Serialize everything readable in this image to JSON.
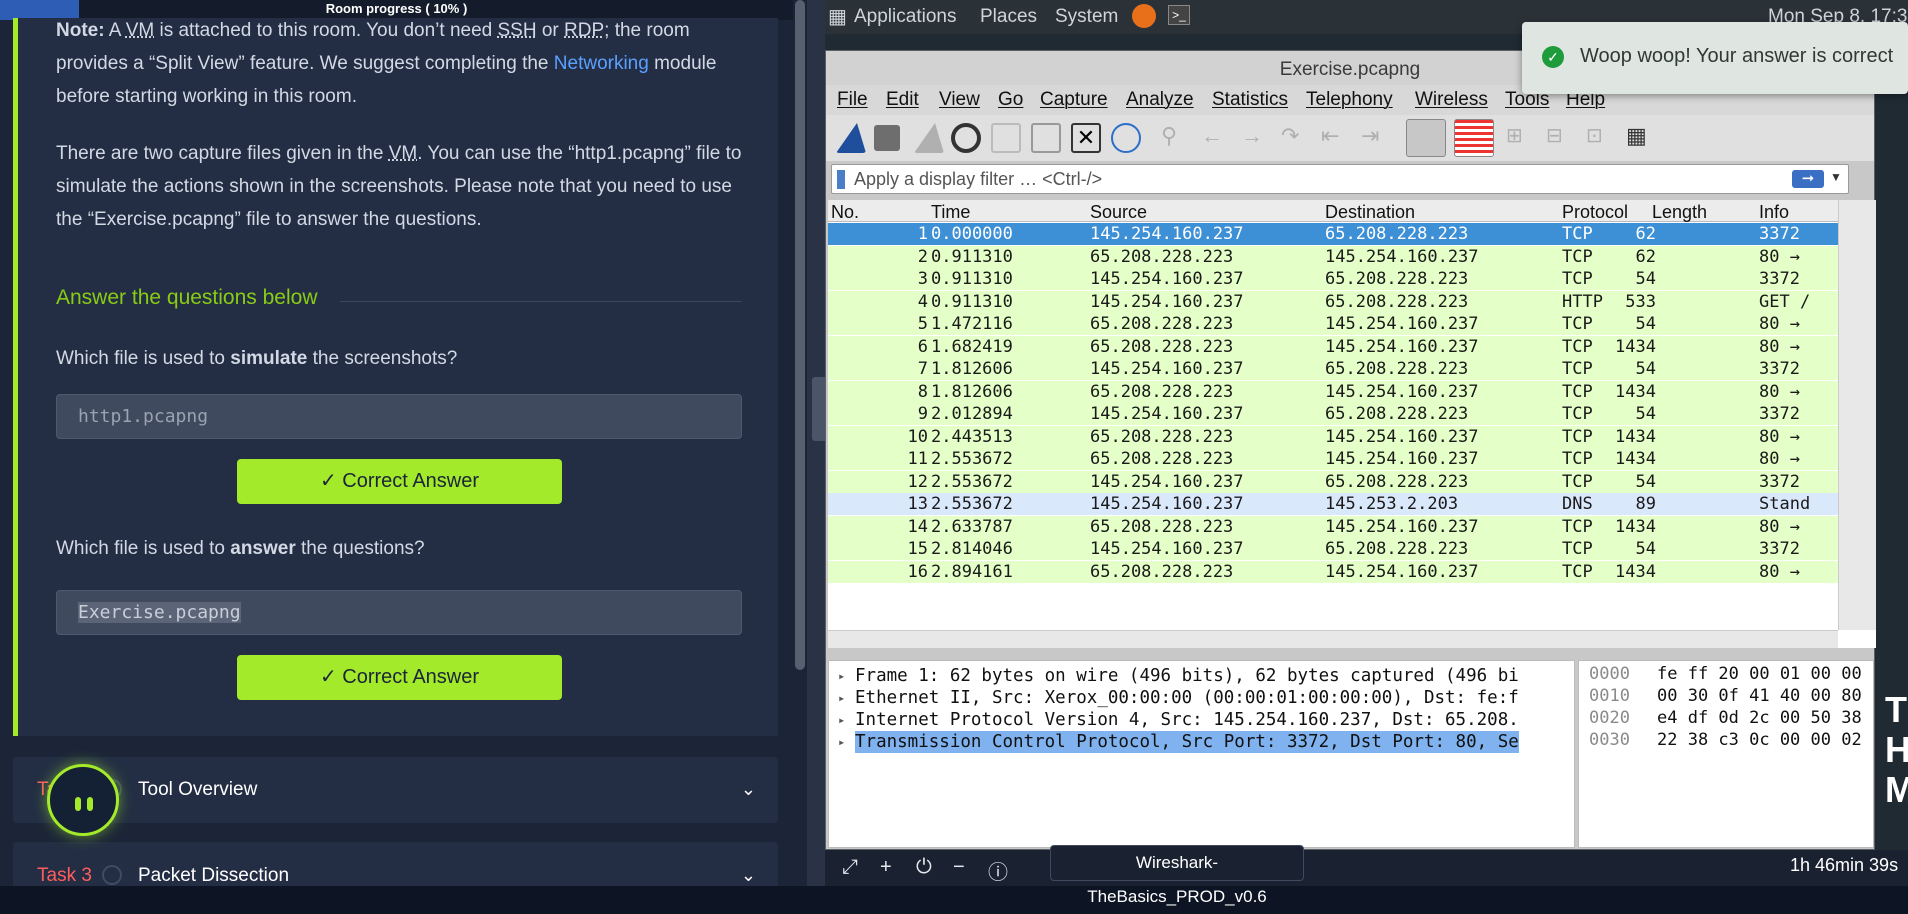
{
  "progress": {
    "label": "Room progress ( 10% )",
    "fraction": 0.1
  },
  "task": {
    "note_bold": "Note:",
    "note_1": " A ",
    "vm": "VM",
    "note_2": " is attached to this room. You don’t need ",
    "ssh": "SSH",
    "or": " or ",
    "rdp": "RDP",
    "note_3": "; the room",
    "note_line2_a": "provides a “Split View” feature. We suggest completing the ",
    "networking": "Networking",
    "note_line2_b": " module",
    "note_line3": "before starting working in this room.",
    "p2_line1_a": "There are two capture files given in the ",
    "p2_vm": "VM",
    "p2_line1_b": ". You can use the “http1.pcapng” file to",
    "p2_line2": "simulate the actions shown in the screenshots. Please note that you need to use",
    "p2_line3": "the “Exercise.pcapng” file to answer the questions."
  },
  "answers": {
    "heading": "Answer the questions below",
    "q1_a": "Which file is used to ",
    "q1_b": "simulate",
    "q1_c": " the screenshots?",
    "a1": "http1.pcapng",
    "q2_a": "Which file is used to ",
    "q2_b": "answer",
    "q2_c": " the questions?",
    "a2": "Exercise.pcapng",
    "correct_label": "✓ Correct Answer"
  },
  "tasks": [
    {
      "num": "Ta",
      "title": "Tool Overview"
    },
    {
      "num": "Task 3",
      "title": "Packet Dissection"
    }
  ],
  "topbar": {
    "apps": "Applications",
    "places": "Places",
    "system": "System",
    "clock": "Mon Sep  8, 17:3"
  },
  "toast": "Woop woop! Your answer is correct",
  "wireshark": {
    "title": "Exercise.pcapng",
    "menu": [
      "File",
      "Edit",
      "View",
      "Go",
      "Capture",
      "Analyze",
      "Statistics",
      "Telephony",
      "Wireless",
      "Tools",
      "Help"
    ],
    "filter_placeholder": "Apply a display filter … <Ctrl-/>",
    "columns": [
      "No.",
      "Time",
      "Source",
      "Destination",
      "Protocol",
      "Length",
      "Info"
    ],
    "packets": [
      {
        "no": "1",
        "time": "0.000000",
        "src": "145.254.160.237",
        "dst": "65.208.228.223",
        "proto": "TCP",
        "len": "62",
        "info": "3372"
      },
      {
        "no": "2",
        "time": "0.911310",
        "src": "65.208.228.223",
        "dst": "145.254.160.237",
        "proto": "TCP",
        "len": "62",
        "info": "80 →"
      },
      {
        "no": "3",
        "time": "0.911310",
        "src": "145.254.160.237",
        "dst": "65.208.228.223",
        "proto": "TCP",
        "len": "54",
        "info": "3372"
      },
      {
        "no": "4",
        "time": "0.911310",
        "src": "145.254.160.237",
        "dst": "65.208.228.223",
        "proto": "HTTP",
        "len": "533",
        "info": "GET /"
      },
      {
        "no": "5",
        "time": "1.472116",
        "src": "65.208.228.223",
        "dst": "145.254.160.237",
        "proto": "TCP",
        "len": "54",
        "info": "80 →"
      },
      {
        "no": "6",
        "time": "1.682419",
        "src": "65.208.228.223",
        "dst": "145.254.160.237",
        "proto": "TCP",
        "len": "1434",
        "info": "80 →"
      },
      {
        "no": "7",
        "time": "1.812606",
        "src": "145.254.160.237",
        "dst": "65.208.228.223",
        "proto": "TCP",
        "len": "54",
        "info": "3372"
      },
      {
        "no": "8",
        "time": "1.812606",
        "src": "65.208.228.223",
        "dst": "145.254.160.237",
        "proto": "TCP",
        "len": "1434",
        "info": "80 →"
      },
      {
        "no": "9",
        "time": "2.012894",
        "src": "145.254.160.237",
        "dst": "65.208.228.223",
        "proto": "TCP",
        "len": "54",
        "info": "3372"
      },
      {
        "no": "10",
        "time": "2.443513",
        "src": "65.208.228.223",
        "dst": "145.254.160.237",
        "proto": "TCP",
        "len": "1434",
        "info": "80 →"
      },
      {
        "no": "11",
        "time": "2.553672",
        "src": "65.208.228.223",
        "dst": "145.254.160.237",
        "proto": "TCP",
        "len": "1434",
        "info": "80 →"
      },
      {
        "no": "12",
        "time": "2.553672",
        "src": "145.254.160.237",
        "dst": "65.208.228.223",
        "proto": "TCP",
        "len": "54",
        "info": "3372"
      },
      {
        "no": "13",
        "time": "2.553672",
        "src": "145.254.160.237",
        "dst": "145.253.2.203",
        "proto": "DNS",
        "len": "89",
        "info": "Stand"
      },
      {
        "no": "14",
        "time": "2.633787",
        "src": "65.208.228.223",
        "dst": "145.254.160.237",
        "proto": "TCP",
        "len": "1434",
        "info": "80 →"
      },
      {
        "no": "15",
        "time": "2.814046",
        "src": "145.254.160.237",
        "dst": "65.208.228.223",
        "proto": "TCP",
        "len": "54",
        "info": "3372"
      },
      {
        "no": "16",
        "time": "2.894161",
        "src": "65.208.228.223",
        "dst": "145.254.160.237",
        "proto": "TCP",
        "len": "1434",
        "info": "80 →"
      }
    ],
    "details": [
      "Frame 1: 62 bytes on wire (496 bits), 62 bytes captured (496 bi",
      "Ethernet II, Src: Xerox_00:00:00 (00:00:01:00:00:00), Dst: fe:f",
      "Internet Protocol Version 4, Src: 145.254.160.237, Dst: 65.208.",
      "Transmission Control Protocol, Src Port: 3372, Dst Port: 80, Se"
    ],
    "hex": [
      {
        "off": "0000",
        "bytes": "fe ff 20 00 01 00 00"
      },
      {
        "off": "0010",
        "bytes": "00 30 0f 41 40 00 80"
      },
      {
        "off": "0020",
        "bytes": "e4 df 0d 2c 00 50 38"
      },
      {
        "off": "0030",
        "bytes": "22 38 c3 0c 00 00 02"
      }
    ]
  },
  "bottombar": {
    "vm_name": "Wireshark-TheBasics_PROD_v0.6",
    "timer": "1h 46min 39s"
  },
  "side_letters": "T\nH\nM",
  "colors": {
    "accent": "#a3ea2a",
    "tcp_row": "#e4ffc7",
    "dns_row": "#dae8fc",
    "selected_row": "#3d8fd6",
    "link": "#5aa0ff"
  }
}
